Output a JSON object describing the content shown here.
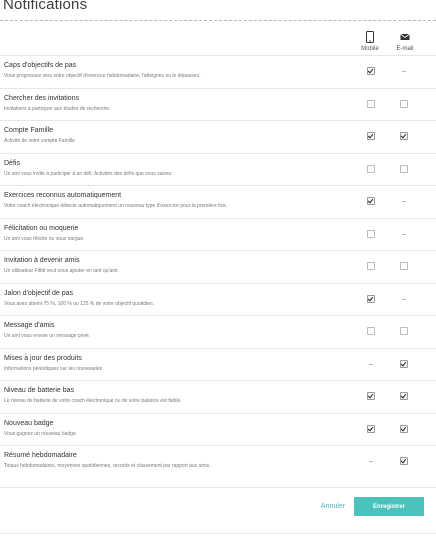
{
  "page": {
    "title": "Notifications"
  },
  "columns": {
    "mobile": {
      "label": "Mobile",
      "icon": "mobile-phone-icon"
    },
    "email": {
      "label": "E-mail",
      "icon": "envelope-icon"
    }
  },
  "rows": [
    {
      "name": "Caps d'objectifs de pas",
      "desc": "Vous progressez vers votre objectif d'exercice hebdomadaire, l'atteignez ou le dépassez.",
      "mobile": "checked",
      "email": "none"
    },
    {
      "name": "Chercher des invitations",
      "desc": "Invitations à participer aux études de recherche.",
      "mobile": "unchecked",
      "email": "unchecked"
    },
    {
      "name": "Compte Famille",
      "desc": "Activité de votre compte Famille",
      "mobile": "checked",
      "email": "checked"
    },
    {
      "name": "Défis",
      "desc": "Un ami vous invite à participer à un défi. Activités des défis que vous suivez.",
      "mobile": "unchecked",
      "email": "unchecked"
    },
    {
      "name": "Exercices reconnus automatiquement",
      "desc": "Votre coach électronique détecte automatiquement un nouveau type d'exercice pour la première fois.",
      "mobile": "checked",
      "email": "none"
    },
    {
      "name": "Félicitation ou moquerie",
      "desc": "Un ami vous félicite ou vous nargue.",
      "mobile": "unchecked",
      "email": "none"
    },
    {
      "name": "Invitation à devenir amis",
      "desc": "Un utilisateur Fitbit veut vous ajouter en tant qu'ami.",
      "mobile": "unchecked",
      "email": "unchecked"
    },
    {
      "name": "Jalon d'objectif de pas",
      "desc": "Vous avez atteint 75 %, 100 % ou 125 % de votre objectif quotidien.",
      "mobile": "checked",
      "email": "none"
    },
    {
      "name": "Message d'amis",
      "desc": "Un ami vous envoie un message privé.",
      "mobile": "unchecked",
      "email": "unchecked"
    },
    {
      "name": "Mises à jour des produits",
      "desc": "Informations périodiques sur les nouveautés",
      "mobile": "none",
      "email": "checked"
    },
    {
      "name": "Niveau de batterie bas",
      "desc": "Le niveau de batterie de votre coach électronique ou de votre balance est faible.",
      "mobile": "checked",
      "email": "checked"
    },
    {
      "name": "Nouveau badge",
      "desc": "Vous gagnez un nouveau badge.",
      "mobile": "checked",
      "email": "checked"
    },
    {
      "name": "Résumé hebdomadaire",
      "desc": "Totaux hebdomadaires, moyennes quotidiennes, records et classement par rapport aux amis.",
      "mobile": "none",
      "email": "checked"
    }
  ],
  "dash_text": "–",
  "actions": {
    "cancel_label": "Annuler",
    "save_label": "Enregistrer"
  },
  "colors": {
    "accent": "#4cc2bf",
    "link": "#4fb3b8"
  }
}
